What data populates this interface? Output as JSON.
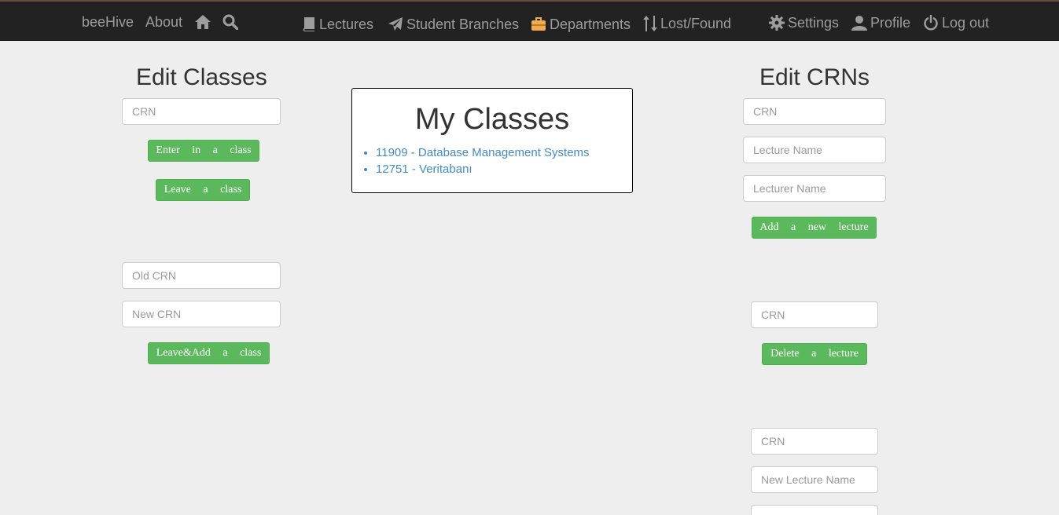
{
  "navbar": {
    "brand": "beeHive",
    "about": "About",
    "lectures": "Lectures",
    "student_branches": "Student Branches",
    "departments": "Departments",
    "lost_found": "Lost/Found",
    "settings": "Settings",
    "profile": "Profile",
    "logout": "Log out",
    "departments_icon_color": "#f0ad4e"
  },
  "edit_classes": {
    "title": "Edit Classes",
    "crn_placeholder": "CRN",
    "enter_button": "Enter in a class",
    "leave_button": "Leave a class",
    "old_crn_placeholder": "Old CRN",
    "new_crn_placeholder": "New CRN",
    "leave_add_button": "Leave&Add a class"
  },
  "my_classes": {
    "title": "My Classes",
    "items": [
      "11909 - Database Management Systems",
      "12751 - Veritabanı"
    ]
  },
  "edit_crns": {
    "title": "Edit CRNs",
    "add_form": {
      "crn_placeholder": "CRN",
      "lecture_name_placeholder": "Lecture Name",
      "lecturer_name_placeholder": "Lecturer Name",
      "add_button": "Add a new lecture"
    },
    "delete_form": {
      "crn_placeholder": "CRN",
      "delete_button": "Delete a lecture"
    },
    "rename_form": {
      "crn_placeholder": "CRN",
      "new_lecture_name_placeholder": "New Lecture Name"
    }
  },
  "colors": {
    "navbar_bg": "#222222",
    "button_green": "#5cb85c",
    "link_blue": "#428bca",
    "page_bg": "#eeeeee"
  }
}
